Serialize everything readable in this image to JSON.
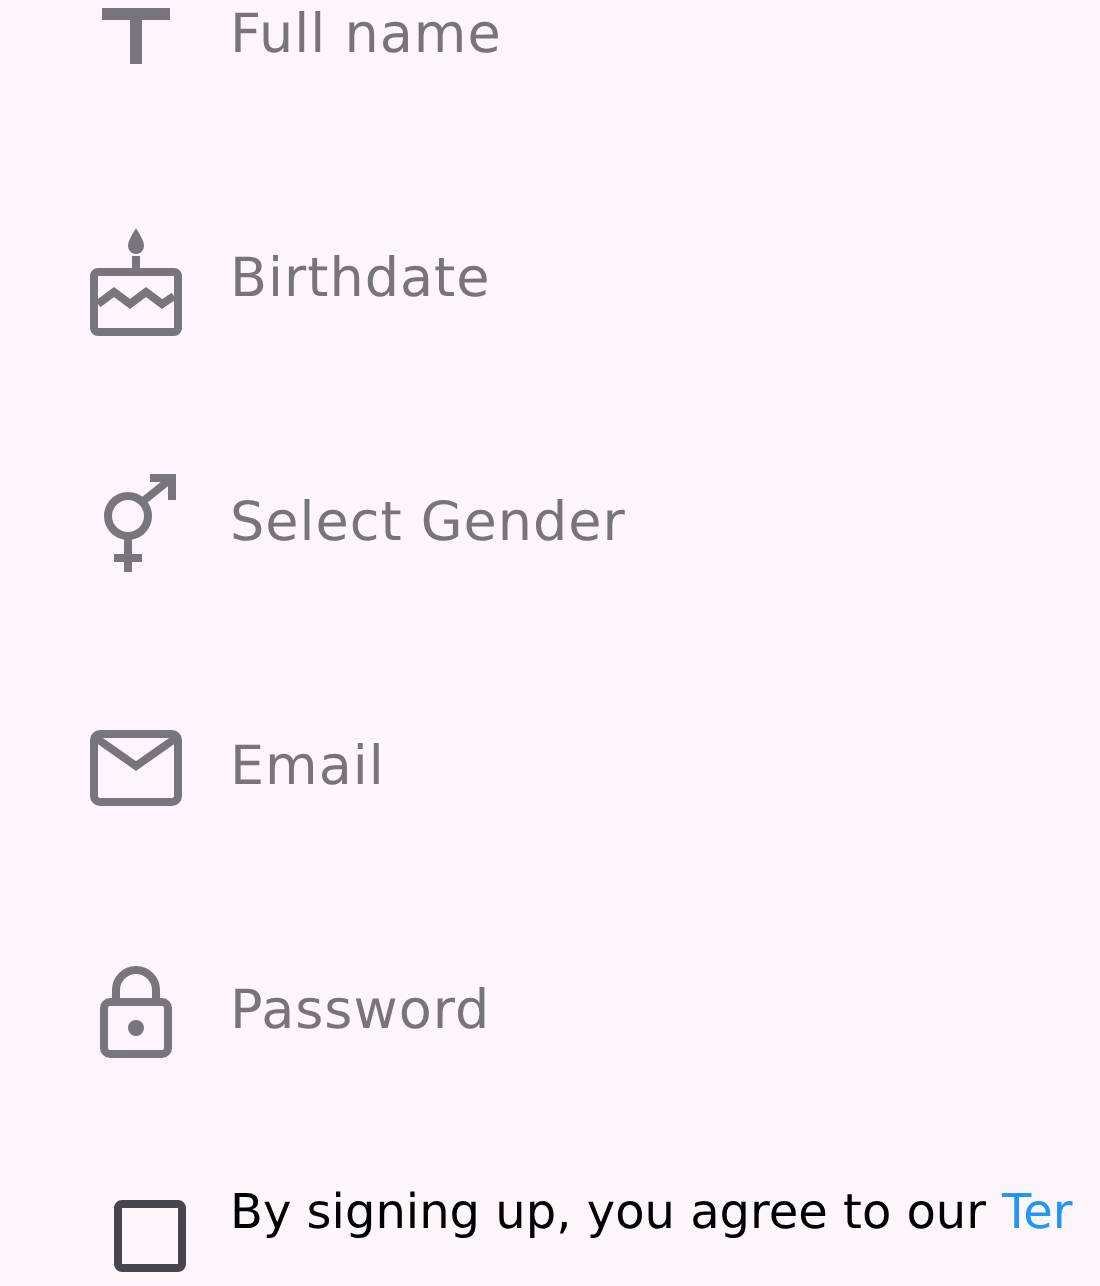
{
  "fields": [
    {
      "kind": "text",
      "placeholder": "Full name"
    },
    {
      "kind": "date",
      "placeholder": "Birthdate"
    },
    {
      "kind": "gender",
      "placeholder": "Select Gender"
    },
    {
      "kind": "email",
      "placeholder": "Email"
    },
    {
      "kind": "password",
      "placeholder": "Password"
    }
  ],
  "terms": {
    "checked": false,
    "text": "By signing up, you agree to our",
    "link": "Ter"
  }
}
